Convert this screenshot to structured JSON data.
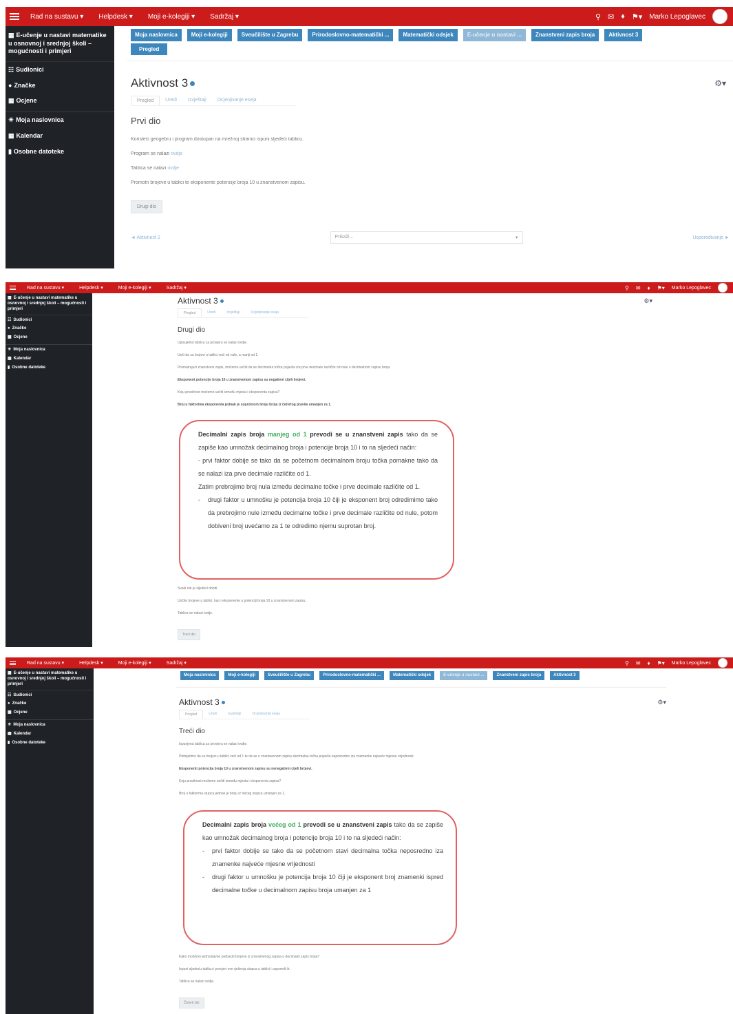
{
  "navbar": {
    "menu": [
      "Rad na sustavu",
      "Helpdesk",
      "Moji e-kolegiji",
      "Sadržaj"
    ],
    "user_name": "Marko Lepoglavec"
  },
  "sidebar": {
    "course": "E-učenje u nastavi matematike u osnovnoj i srednjoj školi – mogućnosti i primjeri",
    "items": [
      "Sudionici",
      "Značke",
      "Ocjene",
      "Moja naslovnica",
      "Kalendar",
      "Osobne datoteke"
    ]
  },
  "breadcrumb": {
    "items": [
      "Moja naslovnica",
      "Moji e-kolegiji",
      "Sveučilište u Zagrebu",
      "Prirodoslovno-matematički ...",
      "Matematički odsjek",
      "E-učenje u nastavi ...",
      "Znanstveni zapis broja",
      "Aktivnost 3"
    ],
    "pregled_button": "Pregled"
  },
  "activity": {
    "title": "Aktivnost 3",
    "tabs": [
      "Pregled",
      "Uredi",
      "Izvještaji",
      "Ocjenjivanje eseja"
    ]
  },
  "panel1": {
    "section_title": "Prvi dio",
    "lines": [
      {
        "text": "Koristeći geogebru i program dostupan na mrežnoj stranici ispuni sljedeći tablicu.",
        "link": ""
      },
      {
        "text": "Program se nalazi ",
        "link": "ovdje"
      },
      {
        "text": "Tablica se nalazi ",
        "link": "ovdje"
      },
      {
        "text": "Promotri brojeve u tablici te eksponente potencije broja 10 u znanstvenom zapisu.",
        "link": ""
      }
    ],
    "next_part_button": "Drugi dio",
    "prev_link": "◄ Aktivnost 2",
    "jump_select": "Prikaži...",
    "next_link": "Usporedivanje ►"
  },
  "panel2": {
    "section_title": "Drugi dio",
    "lines": [
      {
        "text": "Upisujemo tablica za provjeru se nalazi ovdje.",
        "bold": false
      },
      {
        "text": "Uoči da su brojevi u tablici veći od nule, a manji od 1.",
        "bold": false
      },
      {
        "text": "Promatrajući znanstveni zapis, možemo uočiti da se decimalna točka pojavila iza prve decimale različite od nule u decimalnom zapisu broja.",
        "bold": false
      },
      {
        "text": "Eksponent potencije broja 10 u znanstvenom zapisu su negativni cijeli brojevi.",
        "bold": true
      },
      {
        "text": "Koju pravilnost možemo uočiti između mjesta i eksponenta zapisa?",
        "bold": false
      },
      {
        "text": "Broj u faktorima eksponenta jednak je suprotnom broju broja iz četvrtog pravila umanjen za 1.",
        "bold": true
      }
    ],
    "callout": {
      "intro_bold": "Decimalni zapis broja",
      "intro_green": "manjeg od 1",
      "intro_bold2": "prevodi se u znanstveni zapis",
      "intro_rest": "tako da se zapiše kao umnožak decimalnog broja i potencije broja 10 i to na sljedeći način:",
      "bullet1": "- prvi faktor dobije se tako da se početnom decimalnom broju točka pomakne tako da se nalazi iza prve decimale različite od 1.",
      "middle": "Zatim prebrojimo broj nula između decimalne točke i prve decimale različite od 1.",
      "bullet2": "drugi faktor u umnošku je potencija broja 10 čiji je eksponent broj odredimimo tako da prebrojimo nule između decimalne točke i prve decimale različite od nule, potom dobiveni broj uvećamo za 1 te odredimo njemu suprotan broj."
    },
    "after_lines": [
      "Svaki rok je sljedeći dobiti.",
      "Uočite brojeve u tablici, kao i eksponente u potenciji broja 10 u znanstvenom zapisu.",
      "Tablica se nalazi ovdje."
    ],
    "next_part_button": "Treći dio"
  },
  "panel3": {
    "section_title": "Treći dio",
    "lines": [
      {
        "text": "Ispunjena tablica za provjeru se nalazi ovdje.",
        "bold": false
      },
      {
        "text": "Primijetimo da su brojevi u tablici veći od 1 te da se u znanstvenom zapisu decimalna točka pojavila neposredno iza znamenke najveće mjesne vrijednosti.",
        "bold": false
      },
      {
        "text": "Eksponenti potencija broja 10 u znanstvenom zapisu su nenegativni cijeli brojevi.",
        "bold": true
      },
      {
        "text": "Koju pravilnost možemo uočiti između mjesta i eksponenta zapisa?",
        "bold": false
      },
      {
        "text": "Broj u faktorima stupca jednak je broju iz trećeg stupca umanjen za 1.",
        "bold": false
      }
    ],
    "callout": {
      "intro_bold": "Decimalni zapis broja",
      "intro_green": "većeg od 1",
      "intro_bold2": "prevodi se u znanstveni zapis",
      "intro_rest": "tako da se zapiše kao umnožak decimalnog broja i potencije broja 10 i to na sljedeći način:",
      "bullet1": "prvi faktor dobije se tako da se početnom stavi decimalna točka neposredno iza znamenke najveće mjesne vrijednosti",
      "bullet2": "drugi faktor u umnošku je potencija broja 10 čiji je eksponent broj znamenki ispred decimalne točke u decimalnom zapisu broja umanjen za 1"
    },
    "after_lines": [
      "Kako možemo jednostavno prebaciti brojeve iz znanstvenog zapisa u decimalni zapis broja?",
      "Ispuni sljedeću tablicu i provjeri ove rješenja stupca u tablici i usporedi ih.",
      "Tablica se nalazi ovdje."
    ],
    "next_part_button": "Četvrti dio"
  }
}
